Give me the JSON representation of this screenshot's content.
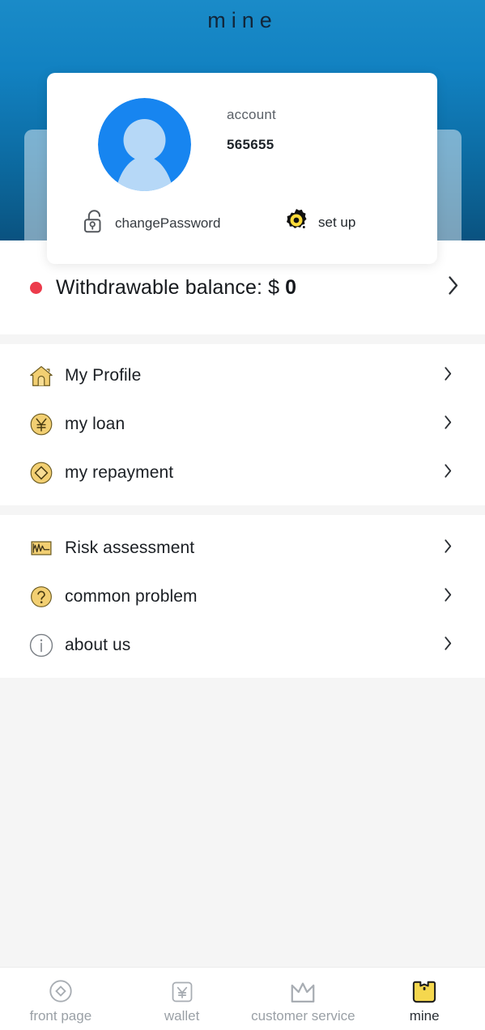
{
  "header": {
    "title": "mine",
    "gradient_top": "#1a8bc8",
    "gradient_bottom": "#0a5280"
  },
  "profile": {
    "avatar_icon": "user-avatar-icon",
    "avatar_ring_color": "#1785f0",
    "avatar_figure_color": "#b6d8f7",
    "account_label": "account",
    "account_value": "565655",
    "actions": [
      {
        "id": "change-password",
        "icon": "unlock-icon",
        "label": "changePassword"
      },
      {
        "id": "set-up",
        "icon": "gear-icon",
        "label": "set up"
      }
    ]
  },
  "balance": {
    "dot_color": "#ec3b4b",
    "label": "Withdrawable balance: $ ",
    "amount": "0",
    "chevron_icon": "chevron-right-icon"
  },
  "menu_groups": [
    {
      "id": "group-account",
      "items": [
        {
          "id": "my-profile",
          "icon": "house-icon",
          "label": "My Profile"
        },
        {
          "id": "my-loan",
          "icon": "yen-coin-icon",
          "label": "my loan"
        },
        {
          "id": "my-repayment",
          "icon": "coin-diamond-icon",
          "label": "my repayment"
        }
      ]
    },
    {
      "id": "group-support",
      "items": [
        {
          "id": "risk-assessment",
          "icon": "chart-waveform-icon",
          "label": "Risk assessment"
        },
        {
          "id": "common-problem",
          "icon": "question-circle-icon",
          "label": "common problem"
        },
        {
          "id": "about-us",
          "icon": "info-circle-icon",
          "label": "about us"
        }
      ]
    }
  ],
  "tabbar": {
    "active_id": "mine",
    "active_color": "#f5d74e",
    "inactive_color": "#9aa0a6",
    "tabs": [
      {
        "id": "front-page",
        "icon": "circle-diamond-icon",
        "label": "front page"
      },
      {
        "id": "wallet",
        "icon": "yen-square-icon",
        "label": "wallet"
      },
      {
        "id": "customer-service",
        "icon": "crown-icon",
        "label": "customer service"
      },
      {
        "id": "mine",
        "icon": "wallet-person-icon",
        "label": "mine"
      }
    ]
  }
}
